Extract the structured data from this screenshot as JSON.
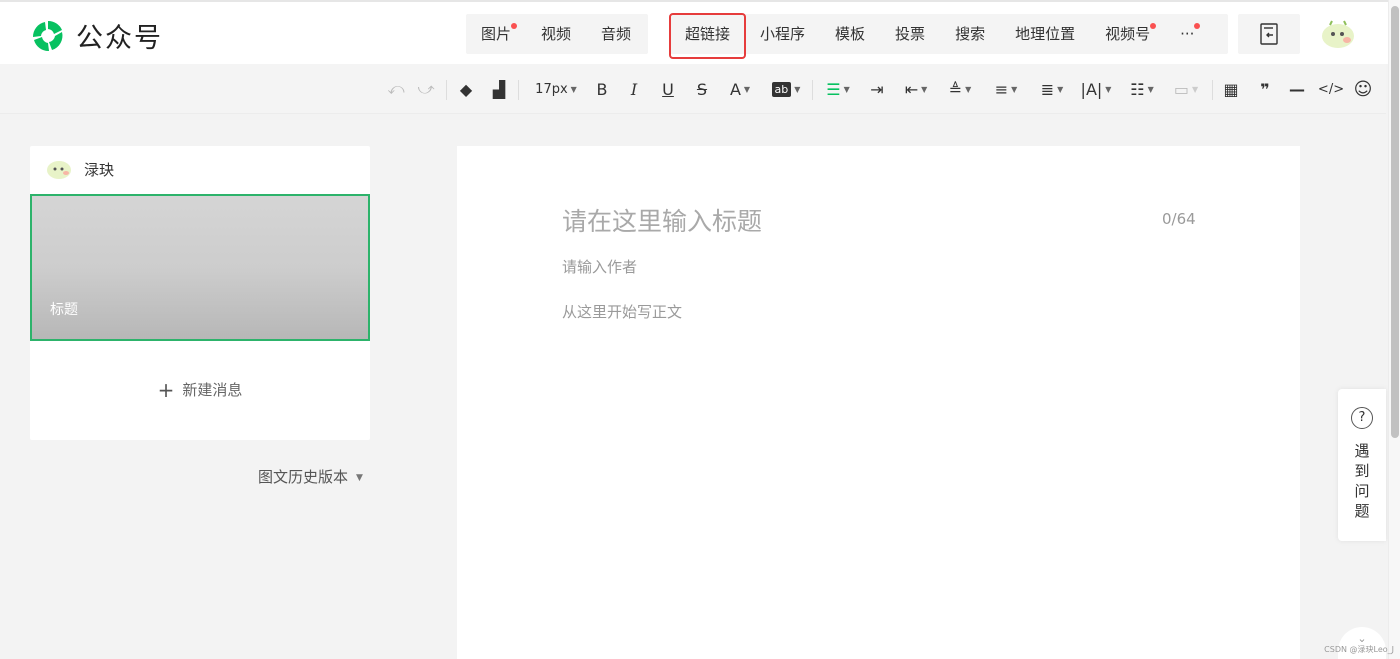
{
  "app": {
    "name": "公众号",
    "brand_color": "#07c160"
  },
  "topbar": {
    "media_items": [
      {
        "label": "图片",
        "badge": true
      },
      {
        "label": "视频",
        "badge": false
      },
      {
        "label": "音频",
        "badge": false
      }
    ],
    "insert_items": [
      {
        "label": "超链接",
        "badge": false,
        "highlighted": true
      },
      {
        "label": "小程序",
        "badge": false
      },
      {
        "label": "模板",
        "badge": false
      },
      {
        "label": "投票",
        "badge": false
      },
      {
        "label": "搜索",
        "badge": false
      },
      {
        "label": "地理位置",
        "badge": false
      },
      {
        "label": "视频号",
        "badge": true
      },
      {
        "label": "···",
        "badge": true
      }
    ],
    "highlight_color": "#e63c3c",
    "doc_icon": "document-import-icon",
    "avatar_icon": "avatar-icon"
  },
  "format_toolbar": {
    "font_size": "17px",
    "items": [
      "undo-icon",
      "redo-icon",
      "clear-format-icon",
      "format-painter-icon",
      "font-size-select",
      "bold-icon",
      "italic-icon",
      "underline-icon",
      "strikethrough-icon",
      "font-color-icon",
      "background-color-icon",
      "align-icon",
      "indent-icon",
      "outdent-icon",
      "line-height-icon",
      "paragraph-spacing-icon",
      "indent-first-icon",
      "letter-spacing-icon",
      "list-icon",
      "float-icon",
      "table-icon",
      "quote-icon",
      "divider-icon",
      "code-icon",
      "emoji-icon"
    ],
    "active_color": "#07c160"
  },
  "left_panel": {
    "account_name": "渌玦",
    "article_title": "标题",
    "new_message": "新建消息",
    "history": "图文历史版本"
  },
  "editor": {
    "title_placeholder": "请在这里输入标题",
    "title_count": "0/64",
    "author_placeholder": "请输入作者",
    "body_placeholder": "从这里开始写正文"
  },
  "help": {
    "label": "遇到问题",
    "icon": "question-icon"
  },
  "watermark": "CSDN @渌玦Leo_J"
}
